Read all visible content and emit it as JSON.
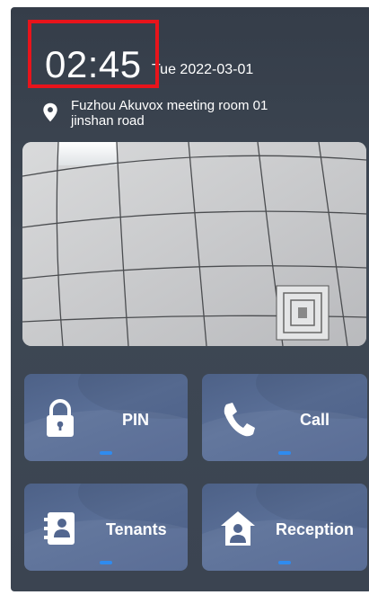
{
  "header": {
    "time": "02:45",
    "date": "Tue 2022-03-01",
    "location_line1": "Fuzhou Akuvox meeting room 01",
    "location_line2": "jinshan road"
  },
  "icons": {
    "location": "location-pin-icon",
    "pin": "lock-icon",
    "call": "phone-icon",
    "tenants": "contacts-book-icon",
    "reception": "house-person-icon"
  },
  "tiles": [
    {
      "label": "PIN"
    },
    {
      "label": "Call"
    },
    {
      "label": "Tenants"
    },
    {
      "label": "Reception"
    }
  ],
  "colors": {
    "highlight": "#e8141b",
    "tile_indicator": "#2f8bef",
    "tile_background": "#5468 90"
  }
}
